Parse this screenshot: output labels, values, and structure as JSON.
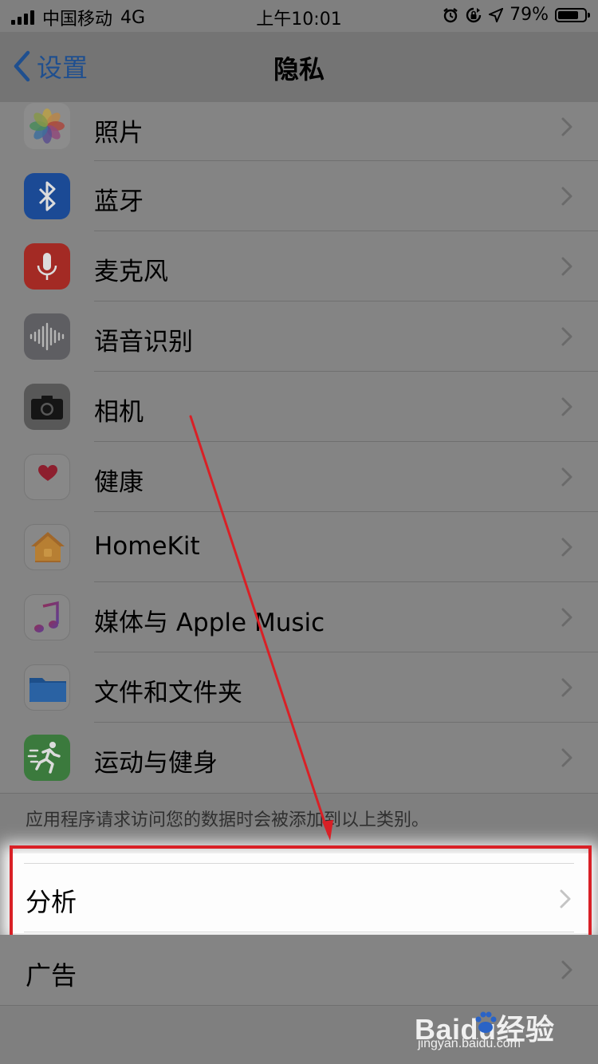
{
  "status_bar": {
    "carrier": "中国移动",
    "network": "4G",
    "time": "上午10:01",
    "battery_percent": "79%",
    "battery_level": 0.79,
    "icons": [
      "signal-icon",
      "alarm-icon",
      "rotation-lock-icon",
      "location-icon",
      "battery-icon"
    ]
  },
  "nav": {
    "back_label": "设置",
    "title": "隐私"
  },
  "privacy_items": [
    {
      "label": "照片",
      "icon": "photos-icon"
    },
    {
      "label": "蓝牙",
      "icon": "bluetooth-icon"
    },
    {
      "label": "麦克风",
      "icon": "microphone-icon"
    },
    {
      "label": "语音识别",
      "icon": "speech-recognition-icon"
    },
    {
      "label": "相机",
      "icon": "camera-icon"
    },
    {
      "label": "健康",
      "icon": "health-icon"
    },
    {
      "label": "HomeKit",
      "icon": "homekit-icon"
    },
    {
      "label": "媒体与 Apple Music",
      "icon": "music-icon"
    },
    {
      "label": "文件和文件夹",
      "icon": "files-icon"
    },
    {
      "label": "运动与健身",
      "icon": "fitness-icon"
    }
  ],
  "footer_note": "应用程序请求访问您的数据时会被添加到以上类别。",
  "analysis": {
    "label": "分析"
  },
  "ads": {
    "label": "广告"
  },
  "watermark": {
    "brand": "Baidu经验",
    "url": "jingyan.baidu.com"
  },
  "colors": {
    "accent": "#1f4f8f",
    "highlight_border": "#d92026",
    "overlay": "#7f7f7f"
  }
}
